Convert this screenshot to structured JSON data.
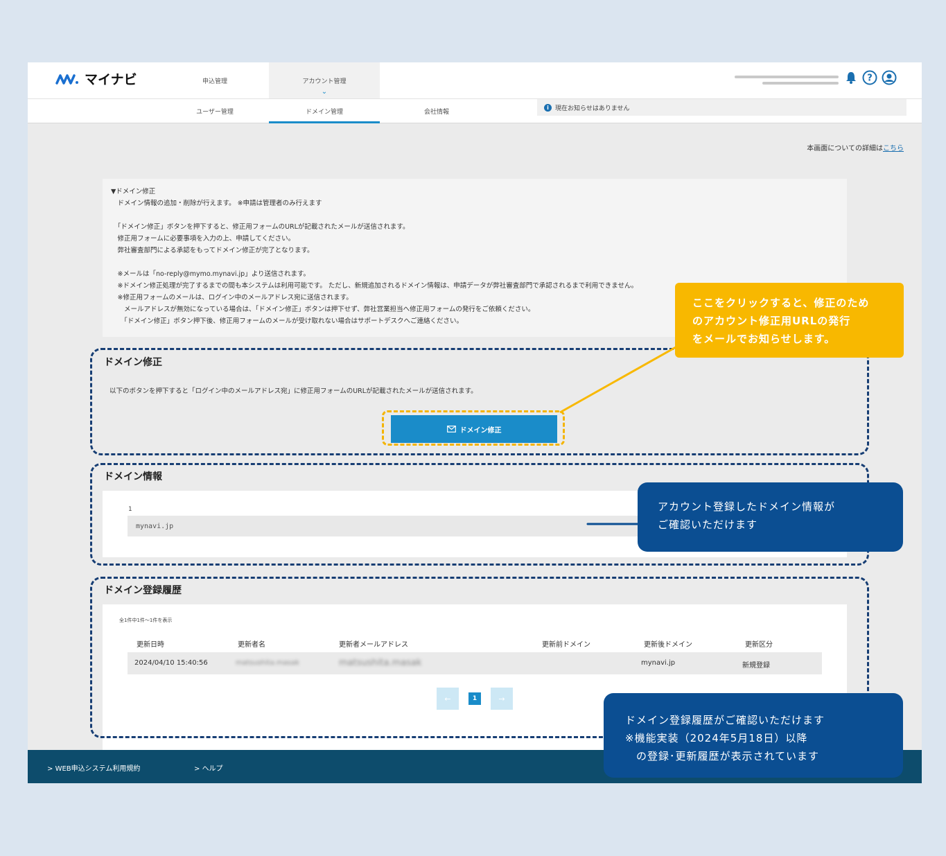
{
  "header": {
    "logo_text": "マイナビ",
    "nav": [
      "申込管理",
      "アカウント管理"
    ],
    "subnav": [
      "ユーザー管理",
      "ドメイン管理",
      "会社情報"
    ],
    "notice": "現在お知らせはありません"
  },
  "page": {
    "detail_prefix": "本画面についての詳細は",
    "detail_link": "こちら"
  },
  "info_box": {
    "lines": [
      "▼ドメイン修正",
      "　ドメイン情報の追加・削除が行えます。 ※申請は管理者のみ行えます",
      "",
      "　「ドメイン修正」ボタンを押下すると、修正用フォームのURLが記載されたメールが送信されます。",
      "　修正用フォームに必要事項を入力の上、申請してください。",
      "　弊社審査部門による承認をもってドメイン修正が完了となります。",
      "",
      "　※メールは「no-reply@mymo.mynavi.jp」より送信されます。",
      "　※ドメイン修正処理が完了するまでの間も本システムは利用可能です。 ただし、新規追加されるドメイン情報は、申請データが弊社審査部門で承認されるまで利用できません。",
      "　※修正用フォームのメールは、ログイン中のメールアドレス宛に送信されます。",
      "　　メールアドレスが無効になっている場合は、「ドメイン修正」ボタンは押下せず、弊社営業担当へ修正用フォームの発行をご依頼ください。",
      "　　「ドメイン修正」ボタン押下後、修正用フォームのメールが受け取れない場合はサポートデスクへご連絡ください。"
    ]
  },
  "domain_fix": {
    "title": "ドメイン修正",
    "description": "以下のボタンを押下すると「ログイン中のメールアドレス宛」に修正用フォームのURLが記載されたメールが送信されます。",
    "button_label": "ドメイン修正"
  },
  "domain_info": {
    "title": "ドメイン情報",
    "index": "1",
    "domain": "mynavi.jp"
  },
  "history": {
    "title": "ドメイン登録履歴",
    "count": "全1件中1件〜1件を表示",
    "columns": [
      "更新日時",
      "更新者名",
      "更新者メールアドレス",
      "更新前ドメイン",
      "更新後ドメイン",
      "更新区分"
    ],
    "rows": [
      [
        "2024/04/10 15:40:56",
        "matsushita.masak",
        "matsushita.masak",
        "",
        "mynavi.jp",
        "新規登録"
      ]
    ],
    "pager": {
      "prev": "←",
      "current": "1",
      "next": "→"
    }
  },
  "footer": {
    "links": [
      "WEB申込システム利用規約",
      "ヘルプ"
    ]
  },
  "callouts": {
    "button_note": [
      "ここをクリックすると、修正のため",
      "のアカウント修正用URLの発行",
      "をメールでお知らせします。"
    ],
    "domain_note": [
      "アカウント登録したドメイン情報が",
      "ご確認いただけます"
    ],
    "history_note": [
      "ドメイン登録履歴がご確認いただけます",
      "※機能実装（2024年5月18日）以降",
      "　の登録･更新履歴が表示されています"
    ]
  },
  "colors": {
    "accent": "#1a8cc9",
    "callout_yellow": "#f8b800",
    "callout_blue": "#0b4e92",
    "dash_border": "#173e74",
    "footer": "#0d4c6c"
  }
}
